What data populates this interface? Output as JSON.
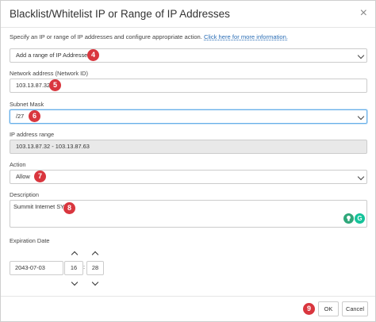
{
  "dialog": {
    "title": "Blacklist/Whitelist IP or Range of IP Addresses",
    "close_glyph": "×"
  },
  "intro": {
    "text": "Specify an IP or range of IP addresses and configure appropriate action.",
    "link": "Click here for more information."
  },
  "type_select": {
    "value": "Add a range of IP Addresses",
    "badge": "4"
  },
  "network": {
    "label": "Network address (Network ID)",
    "value": "103.13.87.32",
    "badge": "5"
  },
  "subnet": {
    "label": "Subnet Mask",
    "value": "/27",
    "badge": "6"
  },
  "ip_range": {
    "label": "IP address range",
    "value": "103.13.87.32 - 103.13.87.63"
  },
  "action": {
    "label": "Action",
    "value": "Allow",
    "badge": "7"
  },
  "description": {
    "label": "Description",
    "value": "Summit Internet SYD",
    "badge": "8",
    "icons": [
      "lightbulb-icon",
      "grammarly-icon"
    ],
    "grammarly_glyph": "G"
  },
  "expiration": {
    "label": "Expiration Date",
    "date": "2043-07-03",
    "hour": "16",
    "separator": ":",
    "minute": "28"
  },
  "footer": {
    "ok_label": "OK",
    "cancel_label": "Cancel",
    "badge": "9"
  },
  "colors": {
    "badge": "#d9363e",
    "link": "#2a6db5",
    "focus": "#66afe9",
    "readonly_bg": "#e9e9e9"
  }
}
